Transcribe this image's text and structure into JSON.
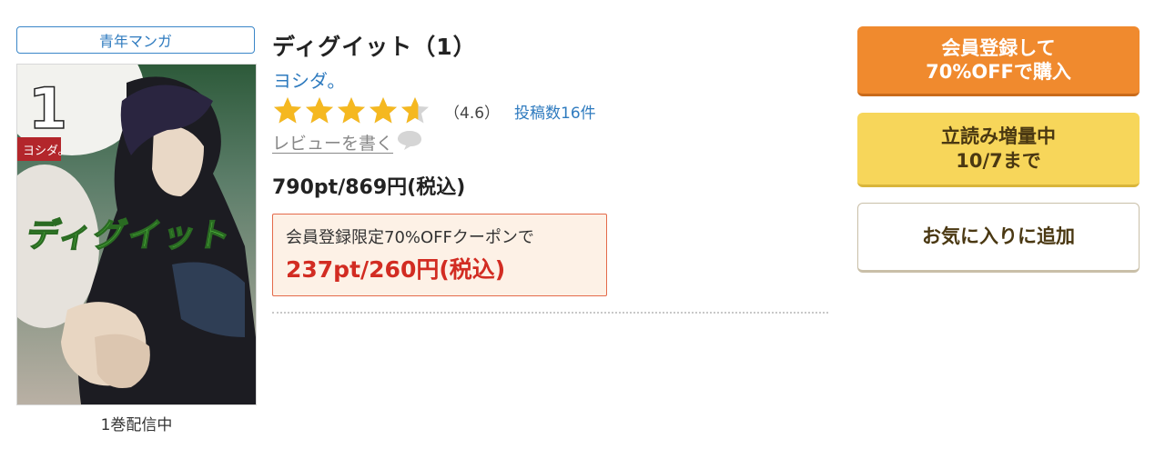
{
  "genre": "青年マンガ",
  "cover": {
    "volume_number": "1",
    "author_on_cover": "ヨシダ。",
    "title_on_cover": "ディグイット",
    "alt": "ディグイット（1）"
  },
  "volume_status": "1巻配信中",
  "book": {
    "title": "ディグイット（1）",
    "author": "ヨシダ。",
    "rating": 4.6,
    "rating_text": "（4.6）",
    "review_count_text": "投稿数16件",
    "write_review_label": "レビューを書く",
    "price": "790pt/869円(税込)"
  },
  "coupon": {
    "description": "会員登録限定70%OFFクーポンで",
    "price": "237pt/260円(税込)"
  },
  "buttons": {
    "register_line1": "会員登録して",
    "register_line2": "70%OFFで購入",
    "tachiyomi_line1": "立読み増量中",
    "tachiyomi_line2": "10/7まで",
    "favorite": "お気に入りに追加"
  },
  "colors": {
    "star_filled": "#f5b820",
    "star_empty": "#d4d4d4",
    "link_blue": "#2f7bbf",
    "register_orange": "#f08a2e",
    "tachiyomi_yellow": "#f7d65a",
    "coupon_red": "#d22c22"
  },
  "icons": {
    "star": "star-icon",
    "review_bubble": "speech-bubble-icon"
  }
}
